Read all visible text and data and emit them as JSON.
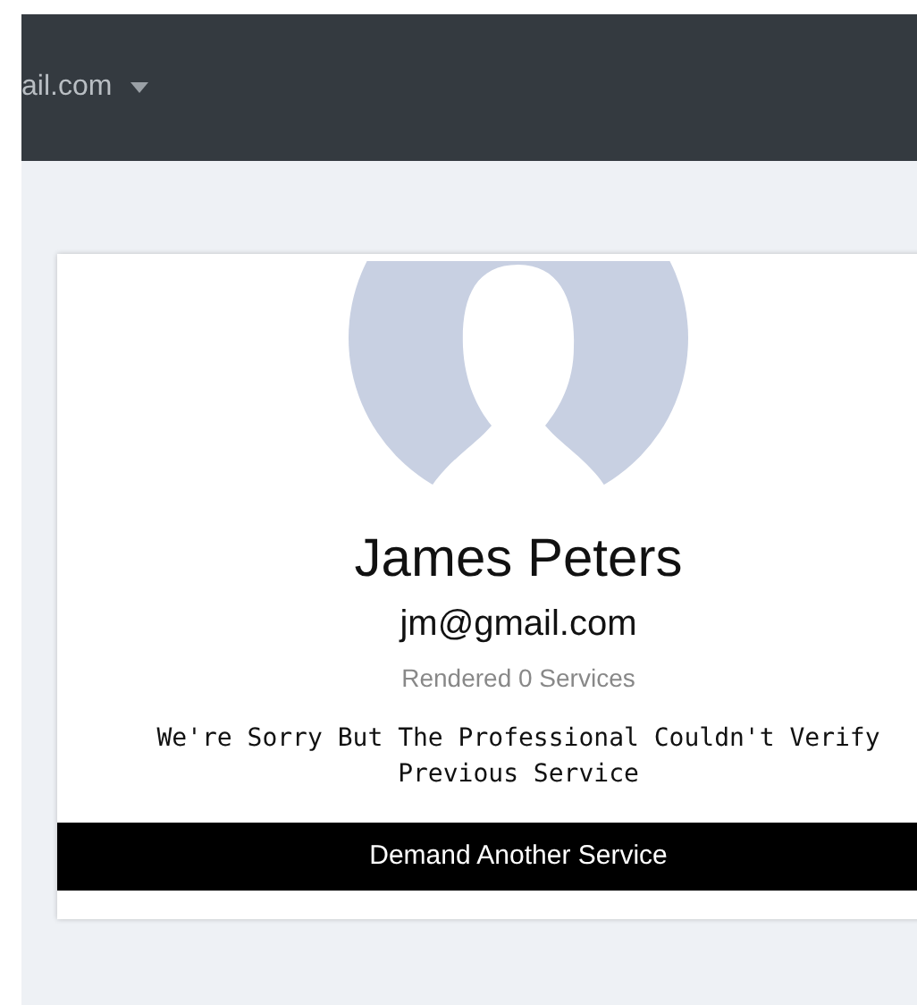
{
  "navbar": {
    "user_menu": "ail.com"
  },
  "profile": {
    "name": "James Peters",
    "email": "jm@gmail.com",
    "services": "Rendered 0 Services",
    "message": "We're Sorry But The Professional Couldn't Verify Previous Service",
    "button": "Demand Another Service"
  }
}
